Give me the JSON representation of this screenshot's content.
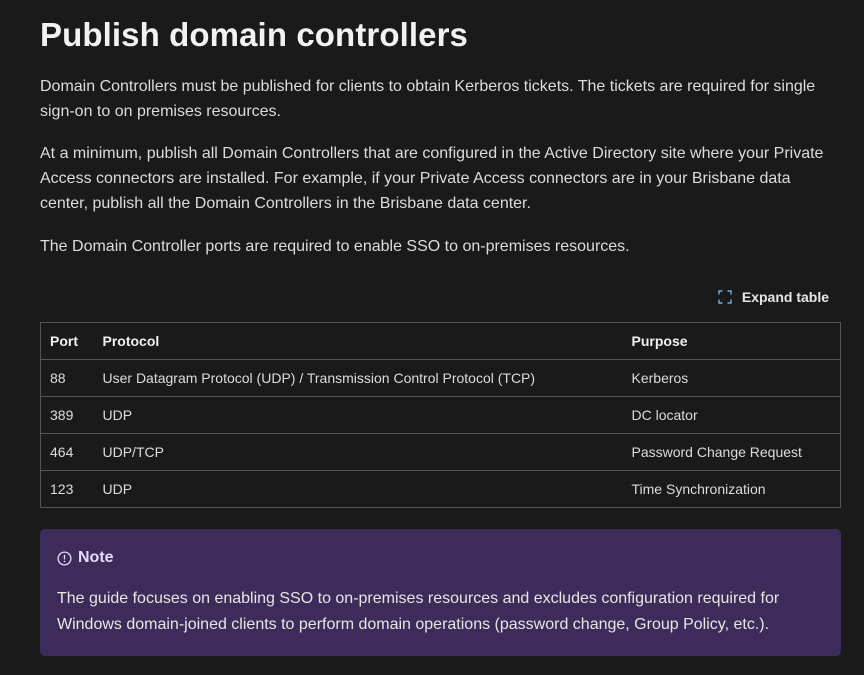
{
  "article": {
    "title": "Publish domain controllers",
    "paragraphs": [
      "Domain Controllers must be published for clients to obtain Kerberos tickets. The tickets are required for single sign-on to on premises resources.",
      "At a minimum, publish all Domain Controllers that are configured in the Active Directory site where your Private Access connectors are installed. For example, if your Private Access connectors are in your Brisbane data center, publish all the Domain Controllers in the Brisbane data center.",
      "The Domain Controller ports are required to enable SSO to on-premises resources."
    ]
  },
  "table": {
    "expand_label": "Expand table",
    "expand_icon": "expand-icon",
    "headers": [
      "Port",
      "Protocol",
      "Purpose"
    ],
    "rows": [
      [
        "88",
        "User Datagram Protocol (UDP) / Transmission Control Protocol (TCP)",
        "Kerberos"
      ],
      [
        "389",
        "UDP",
        "DC locator"
      ],
      [
        "464",
        "UDP/TCP",
        "Password Change Request"
      ],
      [
        "123",
        "UDP",
        "Time Synchronization"
      ]
    ]
  },
  "note": {
    "icon": "info-circle-icon",
    "title": "Note",
    "body": "The guide focuses on enabling SSO to on-premises resources and excludes configuration required for Windows domain-joined clients to perform domain operations (password change, Group Policy, etc.).",
    "background": "#3d2c5a"
  }
}
